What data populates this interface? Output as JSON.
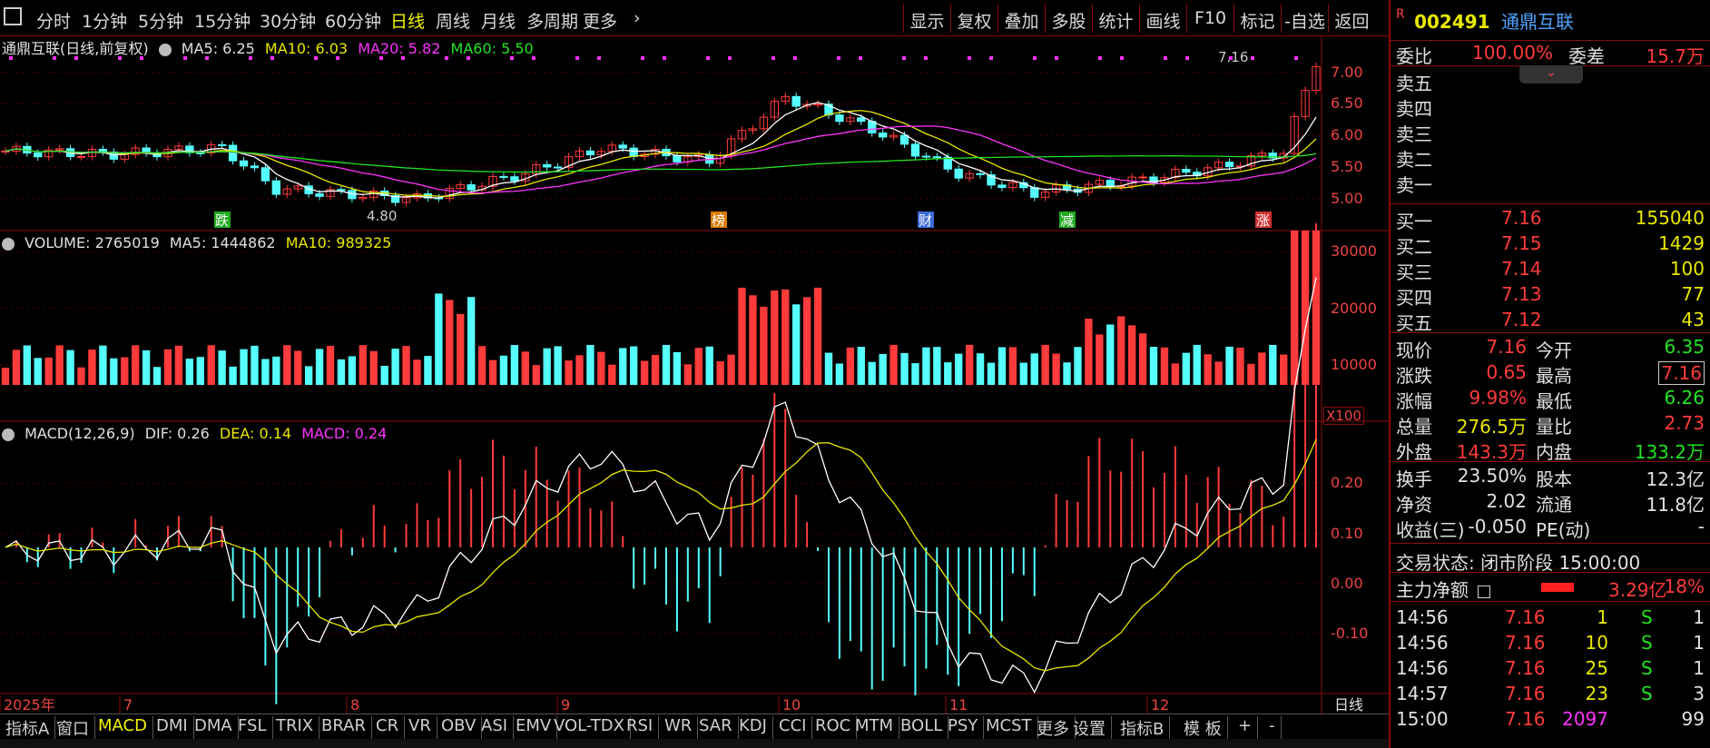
{
  "toolbar": {
    "menu_icon": "menu-icon",
    "periods": [
      "分时",
      "1分钟",
      "5分钟",
      "15分钟",
      "30分钟",
      "60分钟",
      "日线",
      "周线",
      "月线",
      "多周期",
      "更多"
    ],
    "active_period": "日线",
    "right_buttons": [
      "显示",
      "复权",
      "叠加",
      "多股",
      "统计",
      "画线",
      "F10",
      "标记",
      "-自选",
      "返回"
    ]
  },
  "kline": {
    "title": "通鼎互联(日线,前复权)",
    "ma5": "MA5: 6.25",
    "ma10": "MA10: 6.03",
    "ma20": "MA20: 5.82",
    "ma60": "MA60: 5.50",
    "high_label": "7.16",
    "low_label": "4.80",
    "y_ticks": [
      "7.00",
      "6.50",
      "6.00",
      "5.50",
      "5.00"
    ],
    "markers": [
      "跌",
      "榜",
      "财",
      "减",
      "涨"
    ]
  },
  "volume": {
    "title": "VOLUME: 2765019",
    "ma5": "MA5: 1444862",
    "ma10": "MA10: 989325",
    "y_ticks": [
      "30000",
      "20000",
      "10000"
    ],
    "unit": "X100"
  },
  "macd": {
    "title": "MACD(12,26,9)",
    "dif": "DIF: 0.26",
    "dea": "DEA: 0.14",
    "macd": "MACD: 0.24",
    "y_ticks": [
      "0.20",
      "0.10",
      "0.00",
      "-0.10"
    ]
  },
  "time_axis": {
    "labels": [
      "2025年",
      "7",
      "8",
      "9",
      "10",
      "11",
      "12"
    ],
    "period_label": "日线"
  },
  "bottom_tabs": [
    "指标A",
    "窗口",
    "MACD",
    "DMI",
    "DMA",
    "FSL",
    "TRIX",
    "BRAR",
    "CR",
    "VR",
    "OBV",
    "ASI",
    "EMV",
    "VOL-TDX",
    "RSI",
    "WR",
    "SAR",
    "KDJ",
    "CCI",
    "ROC",
    "MTM",
    "BOLL",
    "PSY",
    "MCST",
    "更多",
    "设置",
    "指标B",
    "模 板",
    "+",
    "-"
  ],
  "bottom_active": "MACD",
  "quote": {
    "badge": "R",
    "code": "002491",
    "name": "通鼎互联",
    "weibi_label": "委比",
    "weibi": "100.00%",
    "weicha_label": "委差",
    "weicha": "15.7万",
    "sells": [
      "卖五",
      "卖四",
      "卖三",
      "卖二",
      "卖一"
    ],
    "buys": [
      {
        "label": "买一",
        "price": "7.16",
        "vol": "155040"
      },
      {
        "label": "买二",
        "price": "7.15",
        "vol": "1429"
      },
      {
        "label": "买三",
        "price": "7.14",
        "vol": "100"
      },
      {
        "label": "买四",
        "price": "7.13",
        "vol": "77"
      },
      {
        "label": "买五",
        "price": "7.12",
        "vol": "43"
      }
    ],
    "stats": [
      {
        "l1": "现价",
        "v1": "7.16",
        "l2": "今开",
        "v2": "6.35"
      },
      {
        "l1": "涨跌",
        "v1": "0.65",
        "l2": "最高",
        "v2": "7.16"
      },
      {
        "l1": "涨幅",
        "v1": "9.98%",
        "l2": "最低",
        "v2": "6.26"
      },
      {
        "l1": "总量",
        "v1": "276.5万",
        "l2": "量比",
        "v2": "2.73"
      },
      {
        "l1": "外盘",
        "v1": "143.3万",
        "l2": "内盘",
        "v2": "133.2万"
      }
    ],
    "stats2": [
      {
        "l1": "换手",
        "v1": "23.50%",
        "l2": "股本",
        "v2": "12.3亿"
      },
      {
        "l1": "净资",
        "v1": "2.02",
        "l2": "流通",
        "v2": "11.8亿"
      },
      {
        "l1": "收益(三)",
        "v1": "-0.050",
        "l2": "PE(动)",
        "v2": "-"
      }
    ],
    "trade_status": "交易状态: 闭市阶段 15:00:00",
    "main_flow_label": "主力净额",
    "main_flow_value": "3.29亿",
    "main_flow_pct": "18%",
    "ticks": [
      {
        "t": "14:56",
        "p": "7.16",
        "v": "1",
        "s": "S",
        "n": "1"
      },
      {
        "t": "14:56",
        "p": "7.16",
        "v": "10",
        "s": "S",
        "n": "1"
      },
      {
        "t": "14:56",
        "p": "7.16",
        "v": "25",
        "s": "S",
        "n": "1"
      },
      {
        "t": "14:57",
        "p": "7.16",
        "v": "23",
        "s": "S",
        "n": "3"
      },
      {
        "t": "15:00",
        "p": "7.16",
        "v": "2097",
        "s": "",
        "n": "99"
      }
    ]
  }
}
